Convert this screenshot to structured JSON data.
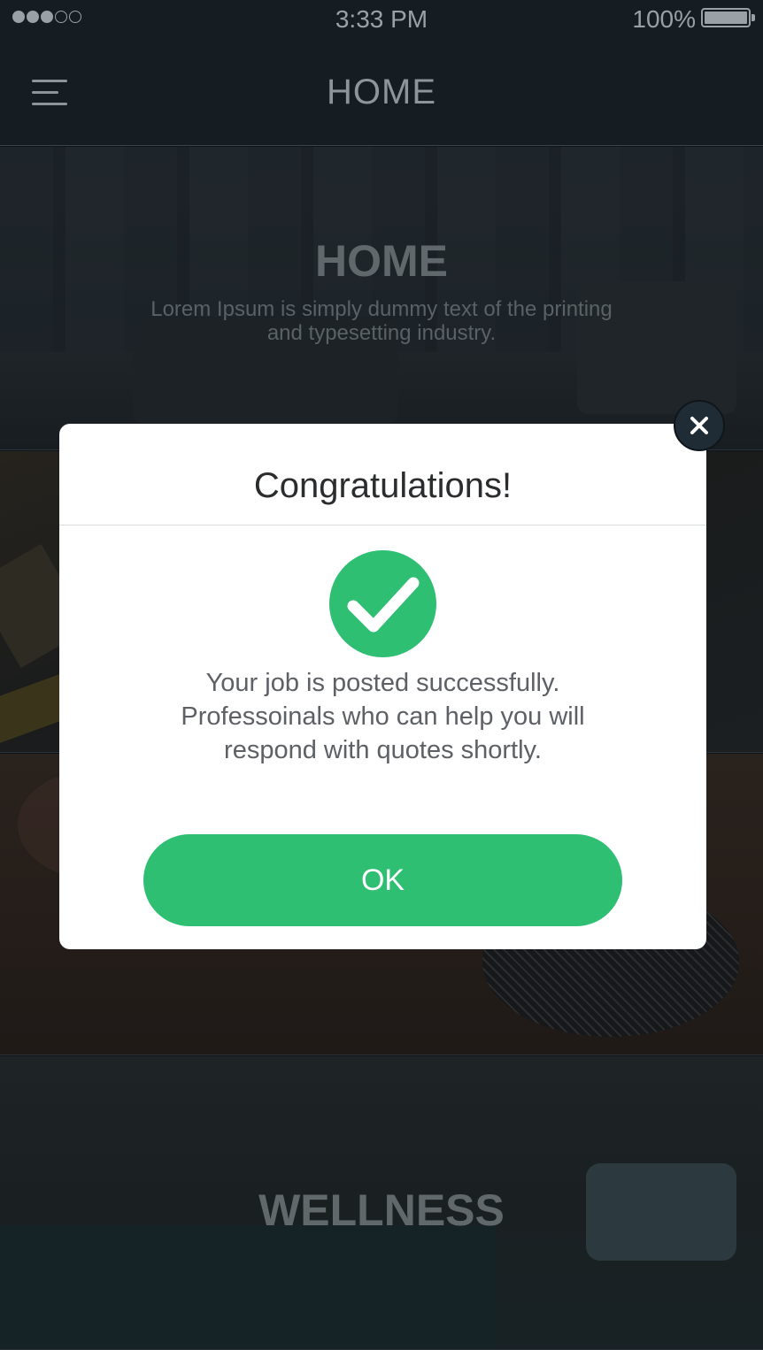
{
  "status_bar": {
    "time": "3:33 PM",
    "battery": "100%",
    "signal_icon": "signal-dots-icon",
    "battery_icon": "battery-icon"
  },
  "nav": {
    "title": "HOME",
    "menu_icon": "hamburger-menu-icon"
  },
  "cards": [
    {
      "title": "HOME",
      "description": "Lorem Ipsum is simply dummy text of the printing and typesetting industry."
    },
    {
      "title": "WELLNESS"
    }
  ],
  "modal": {
    "title": "Congratulations!",
    "icon": "checkmark-circle-icon",
    "message_lines": [
      "Your job is posted successfully.",
      "Professoinals who can help you will",
      "respond with quotes shortly."
    ],
    "ok_label": "OK",
    "close_icon": "close-icon"
  },
  "colors": {
    "accent_green": "#2ebf73",
    "nav_bg": "#151c22",
    "close_button_bg": "#1f2c36"
  }
}
